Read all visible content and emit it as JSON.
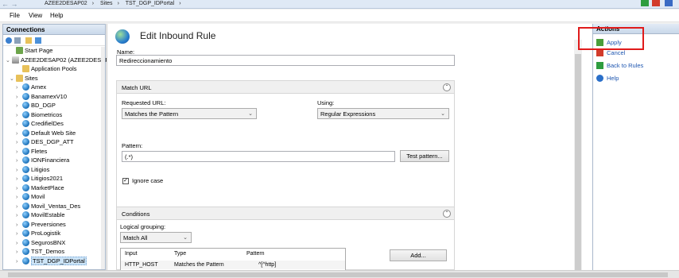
{
  "breadcrumbs": [
    "AZEE2DESAP02",
    "Sites",
    "TST_DGP_IDPortal"
  ],
  "menu": [
    "File",
    "View",
    "Help"
  ],
  "connections": {
    "title": "Connections",
    "tree": [
      {
        "label": "Start Page",
        "indent": 1,
        "icon": "home",
        "exp": ""
      },
      {
        "label": "AZEE2DESAP02 (AZEE2DESAP",
        "indent": 0,
        "icon": "server",
        "exp": "⌄"
      },
      {
        "label": "Application Pools",
        "indent": 2,
        "icon": "folder",
        "exp": ""
      },
      {
        "label": "Sites",
        "indent": 1,
        "icon": "folder",
        "exp": "⌄"
      },
      {
        "label": "Amex",
        "indent": 2,
        "icon": "globe",
        "exp": "›"
      },
      {
        "label": "BanamexV10",
        "indent": 2,
        "icon": "globe",
        "exp": "›"
      },
      {
        "label": "BD_DGP",
        "indent": 2,
        "icon": "globe",
        "exp": "›"
      },
      {
        "label": "Biometricos",
        "indent": 2,
        "icon": "globe",
        "exp": "›"
      },
      {
        "label": "CredifielDes",
        "indent": 2,
        "icon": "globe",
        "exp": "›"
      },
      {
        "label": "Default Web Site",
        "indent": 2,
        "icon": "globe",
        "exp": "›"
      },
      {
        "label": "DES_DGP_ATT",
        "indent": 2,
        "icon": "globe",
        "exp": "›"
      },
      {
        "label": "Fletes",
        "indent": 2,
        "icon": "globe",
        "exp": "›"
      },
      {
        "label": "IONFinanciera",
        "indent": 2,
        "icon": "globe",
        "exp": "›"
      },
      {
        "label": "Litigios",
        "indent": 2,
        "icon": "globe",
        "exp": "›"
      },
      {
        "label": "Litigios2021",
        "indent": 2,
        "icon": "globe",
        "exp": "›"
      },
      {
        "label": "MarketPlace",
        "indent": 2,
        "icon": "globe",
        "exp": "›"
      },
      {
        "label": "Movil",
        "indent": 2,
        "icon": "globe",
        "exp": "›"
      },
      {
        "label": "Movil_Ventas_Des",
        "indent": 2,
        "icon": "globe",
        "exp": "›"
      },
      {
        "label": "MovilEstable",
        "indent": 2,
        "icon": "globe",
        "exp": "›"
      },
      {
        "label": "Preversiones",
        "indent": 2,
        "icon": "globe",
        "exp": "›"
      },
      {
        "label": "ProLogistik",
        "indent": 2,
        "icon": "globe",
        "exp": "›"
      },
      {
        "label": "SegurosBNX",
        "indent": 2,
        "icon": "globe",
        "exp": "›"
      },
      {
        "label": "TST_Demos",
        "indent": 2,
        "icon": "globe",
        "exp": "›"
      },
      {
        "label": "TST_DGP_IDPortal",
        "indent": 2,
        "icon": "globe",
        "exp": "›",
        "selected": true
      }
    ]
  },
  "editor": {
    "title": "Edit Inbound Rule",
    "name_label": "Name:",
    "name_value": "Redireccionamiento",
    "match_url": {
      "header": "Match URL",
      "requested_url_label": "Requested URL:",
      "requested_url_value": "Matches the Pattern",
      "using_label": "Using:",
      "using_value": "Regular Expressions",
      "pattern_label": "Pattern:",
      "pattern_value": "(.*)",
      "test_pattern_button": "Test pattern...",
      "ignore_case_label": "Ignore case"
    },
    "conditions": {
      "header": "Conditions",
      "logical_grouping_label": "Logical grouping:",
      "logical_grouping_value": "Match All",
      "columns": [
        "Input",
        "Type",
        "Pattern"
      ],
      "rows": [
        [
          "HTTP_HOST",
          "Matches the Pattern",
          "^[^http]"
        ]
      ],
      "add_button": "Add..."
    }
  },
  "actions": {
    "title": "Actions",
    "items": [
      "Apply",
      "Cancel",
      "Back to Rules",
      "Help"
    ]
  },
  "colors": {
    "highlight": "#e01b1b",
    "link": "#1e56b0"
  }
}
